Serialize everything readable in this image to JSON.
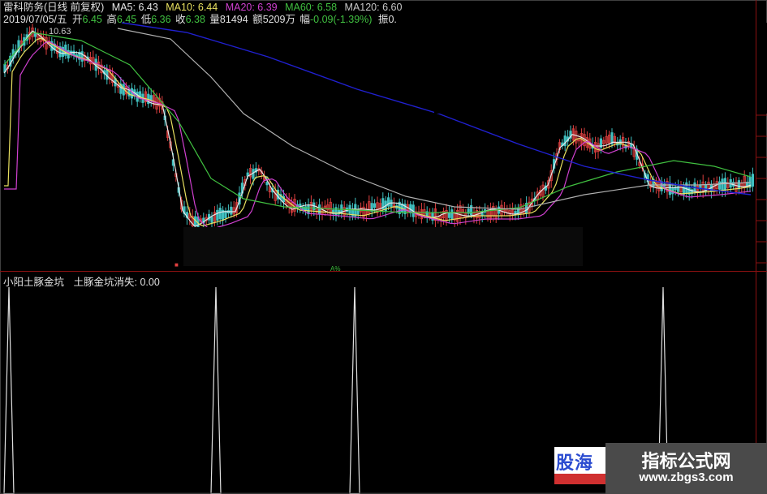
{
  "header": {
    "title": "雷科防务(日线 前复权)",
    "ma5": "MA5: 6.43",
    "ma10": "MA10: 6.44",
    "ma20": "MA20: 6.39",
    "ma60": "MA60: 6.58",
    "ma120": "MA120: 6.60",
    "date": "2019/07/05/五",
    "open_label": "开",
    "open_value": "6.45",
    "high_label": "高",
    "high_value": "6.45",
    "low_label": "低",
    "low_value": "6.36",
    "close_label": "收",
    "close_value": "6.38",
    "vol_label": "量",
    "vol_value": "81494",
    "amt_label": "额",
    "amt_value": "5209万",
    "chg_label": "幅",
    "chg_value": "-0.09(-1.39%)",
    "amp_label": "振",
    "amp_value": "0."
  },
  "main_chart": {
    "peak_label": "10.63",
    "small_label_a": "■",
    "small_label_b": "A%"
  },
  "indicator": {
    "name": "小阳土豚金坑",
    "signal": "土豚金坑消失: 0.00"
  },
  "watermark": {
    "left_text": "股海网",
    "title": "指标公式网",
    "url": "www.zbgs3.com"
  },
  "colors": {
    "ma5": "#e8e8e8",
    "ma10": "#e8e060",
    "ma20": "#d040d0",
    "ma60": "#40c040",
    "ma120": "#b0b0b0",
    "ma250": "#2020d0",
    "up": "#e04040",
    "down": "#40c0c0"
  }
}
